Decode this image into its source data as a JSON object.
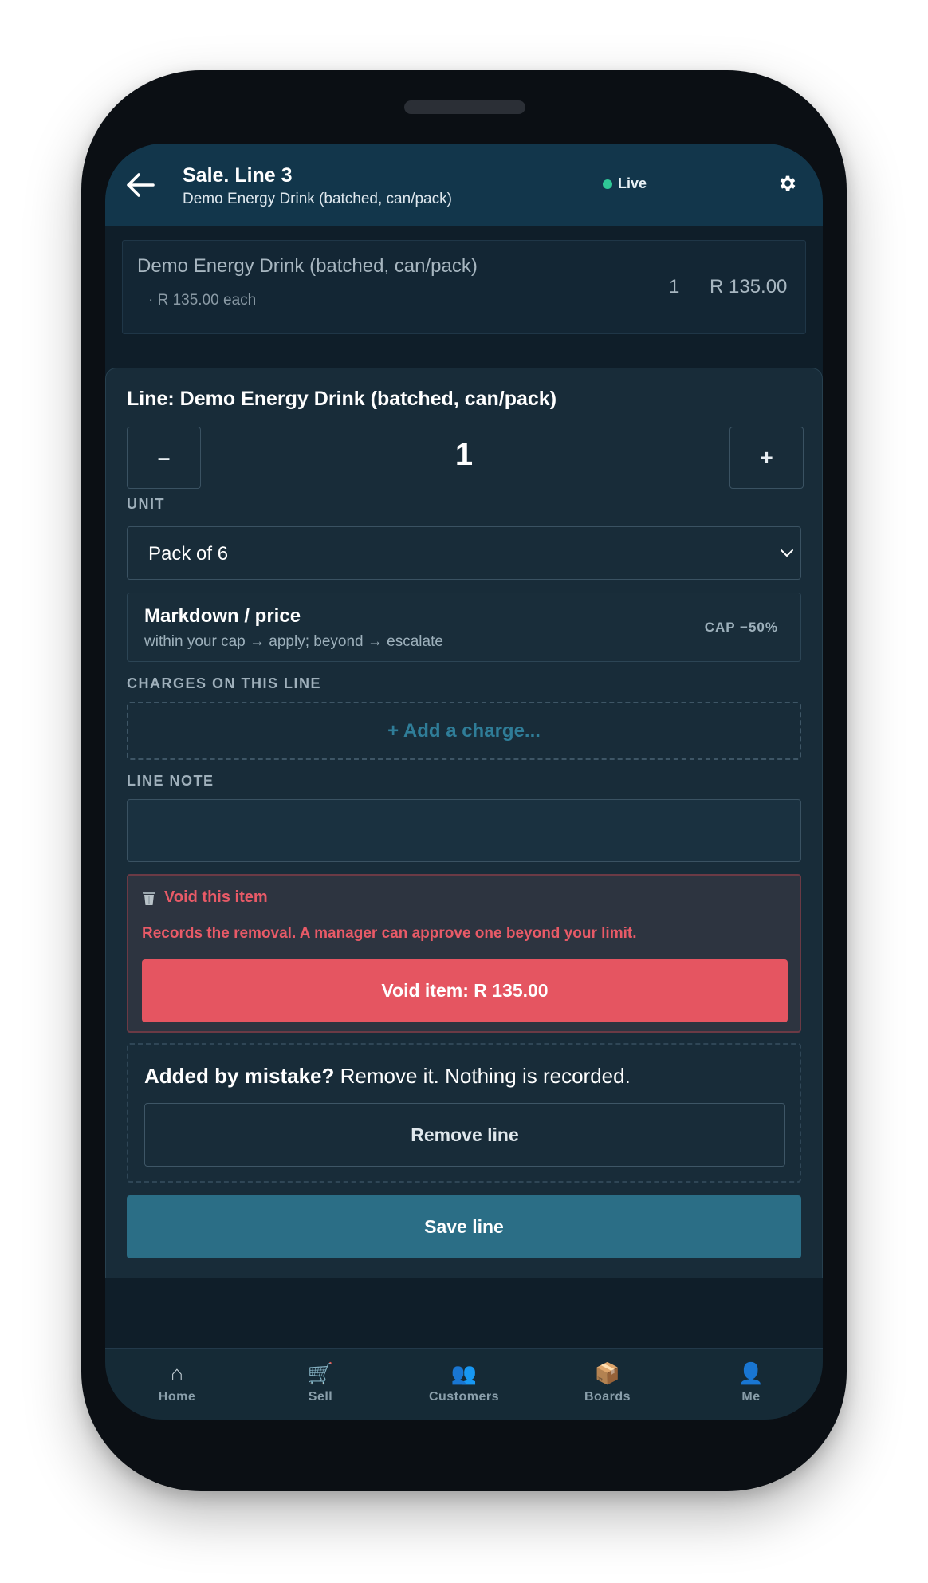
{
  "header": {
    "title": "Sale. Line 3",
    "subtitle": "Demo Energy Drink (batched, can/pack)",
    "status_label": "Live",
    "status_color": "#2fc896"
  },
  "item_row": {
    "name": "Demo Energy Drink (batched, can/pack)",
    "unit_price": "· R 135.00 each",
    "quantity": "1",
    "total": "R 135.00"
  },
  "editor": {
    "title": "Line: Demo Energy Drink (batched, can/pack)",
    "quantity": "1",
    "decrement_label": "–",
    "increment_label": "+",
    "unit_label": "UNIT",
    "unit_value": "Pack of 6",
    "markdown_title": "Markdown / price",
    "markdown_subtitle": "within your cap → apply; beyond → escalate",
    "markdown_cap": "CAP −50%",
    "charges_label": "CHARGES ON THIS LINE",
    "add_charge_label": "+ Add a charge...",
    "note_label": "LINE NOTE",
    "note_value": "",
    "void_title": "Void this item",
    "void_text": "Records the removal. A manager can approve one beyond your limit.",
    "void_button": "Void item: R 135.00",
    "mistake_bold": "Added by mistake?",
    "mistake_text": " Remove it. Nothing is recorded.",
    "remove_button": "Remove line",
    "save_button": "Save line"
  },
  "nav": {
    "items": [
      {
        "label": "Home",
        "icon": "⌂"
      },
      {
        "label": "Sell",
        "icon": "🛒"
      },
      {
        "label": "Customers",
        "icon": "👥"
      },
      {
        "label": "Boards",
        "icon": "📦"
      },
      {
        "label": "Me",
        "icon": "👤"
      }
    ]
  },
  "colors": {
    "header_bg": "#12364b",
    "accent": "#2b6e86",
    "danger": "#e55561"
  }
}
